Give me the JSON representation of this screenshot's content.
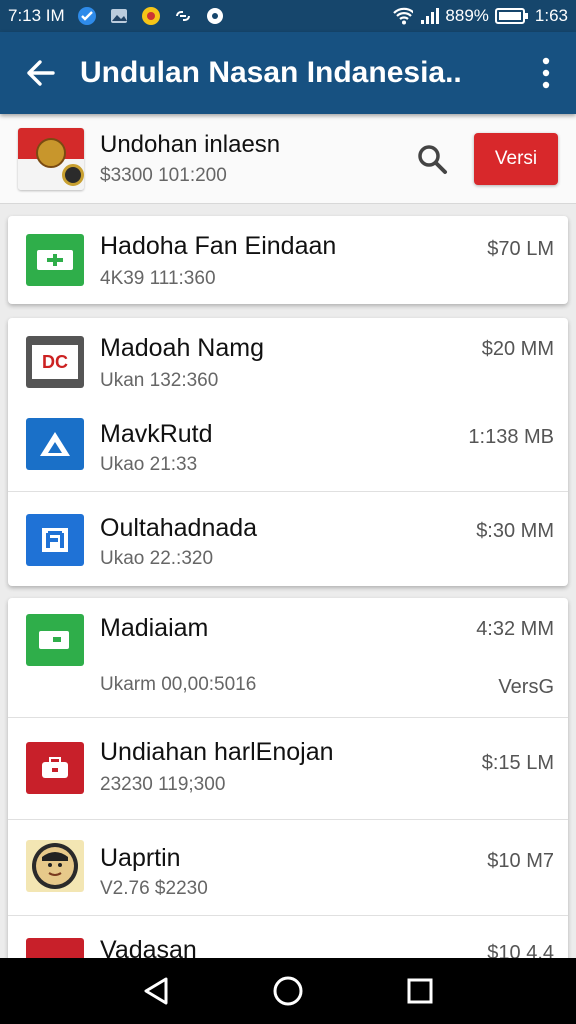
{
  "status_bar": {
    "time": "7:13 IM",
    "battery_text": "889%",
    "clock_right": "1:63"
  },
  "app_bar": {
    "title": "Undulan Nasan Indanesia.."
  },
  "header": {
    "title": "Undohan inlaesn",
    "subtitle": "$3300 101:200",
    "button_label": "Versi"
  },
  "items": [
    {
      "title": "Hadoha Fan Eindaan",
      "sub": "4K39 111:360",
      "size": "$70 LM",
      "icon": "green-plus-icon"
    },
    {
      "title": "Madoah Namg",
      "sub": "Ukan 132:360",
      "size": "$20 MM",
      "icon": "dc-badge-icon"
    },
    {
      "title": "MavkRutd",
      "sub": "Ukao 21:33",
      "size": "1:138 MB",
      "icon": "triangle-icon"
    },
    {
      "title": "Oultahadnada",
      "sub": "Ukao 22.:320",
      "size": "$:30 MM",
      "icon": "document-icon"
    },
    {
      "title": "Madiaiam",
      "sub": "Ukarm 00,00:5016",
      "size": "4:32 MM",
      "extra": "VersG",
      "icon": "green-chat-icon"
    },
    {
      "title": "Undiahan harlEnojan",
      "sub": "23230 119;300",
      "size": "$:15 LM",
      "icon": "red-toolbox-icon"
    },
    {
      "title": "Uaprtin",
      "sub": "V2.76 $2230",
      "size": "$10 M7",
      "icon": "avatar-icon"
    },
    {
      "title": "Vadasan",
      "sub": "",
      "size": "$10 4.4",
      "icon": "red-app-icon"
    }
  ]
}
